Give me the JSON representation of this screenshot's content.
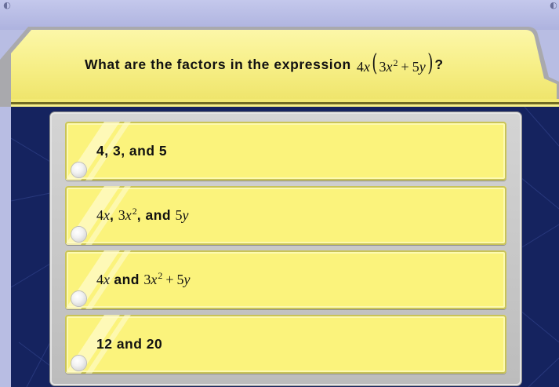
{
  "question": {
    "prefix": "What are the factors in the expression",
    "coef": "4",
    "var_x": "x",
    "inner_coef1": "3",
    "inner_var1": "x",
    "inner_exp": "2",
    "plus": "+",
    "inner_coef2": "5",
    "inner_var2": "y",
    "suffix": "?"
  },
  "answers": [
    {
      "text": "4, 3, and 5"
    },
    {
      "c1": "4",
      "v1": "x",
      "sep1": ",",
      "c2": "3",
      "v2": "x",
      "exp": "2",
      "sep2": ", and",
      "c3": "5",
      "v3": "y"
    },
    {
      "c1": "4",
      "v1": "x",
      "mid": "and",
      "c2": "3",
      "v2": "x",
      "exp": "2",
      "plus": "+",
      "c3": "5",
      "v3": "y"
    },
    {
      "text": "12 and 20"
    }
  ],
  "colors": {
    "topbar": "#b8bde3",
    "tab_yellow": "#f7f08a",
    "board_navy": "#15235f",
    "answer_yellow": "#fbf37c"
  },
  "icons": {
    "corner_left": "clock-icon",
    "corner_right": "clock-icon"
  }
}
